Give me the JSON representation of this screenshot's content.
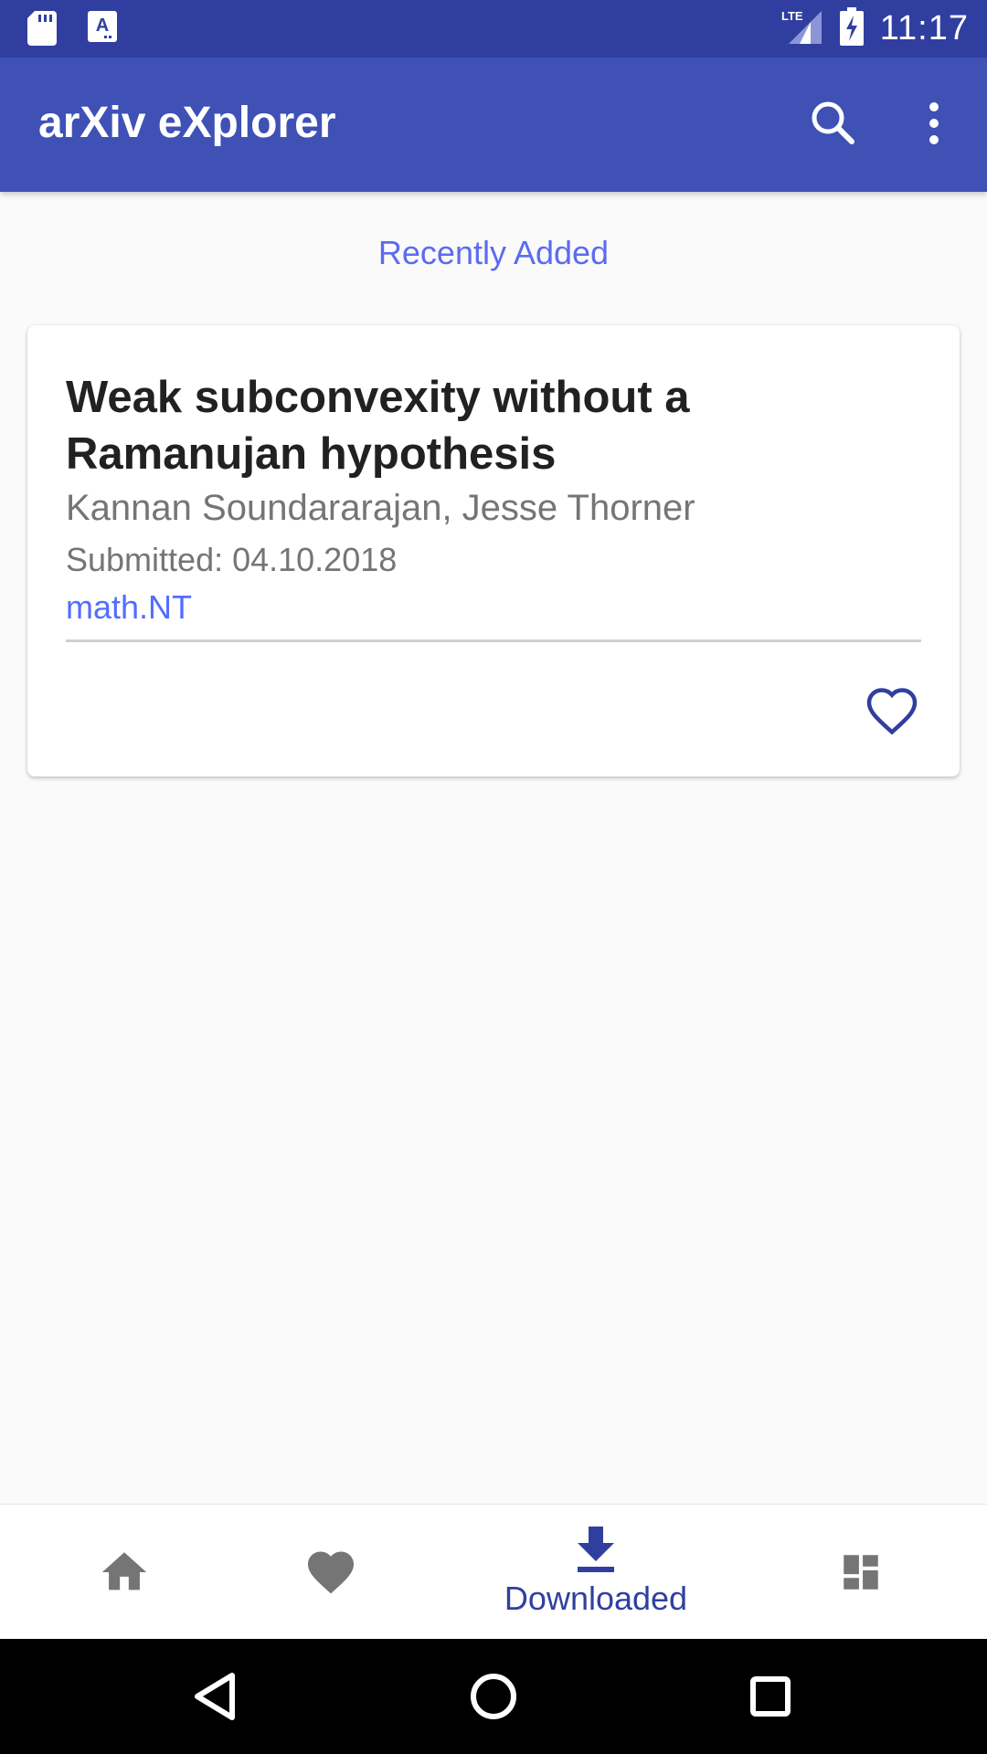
{
  "status_bar": {
    "time": "11:17",
    "network": "LTE",
    "left_icons": [
      "sd-card-icon",
      "font-a-icon"
    ],
    "right_icons": [
      "lte-signal-icon",
      "battery-charging-icon"
    ]
  },
  "app_bar": {
    "title": "arXiv eXplorer",
    "actions": [
      "search-icon",
      "more-vert-icon"
    ]
  },
  "section": {
    "heading": "Recently Added"
  },
  "papers": [
    {
      "title": "Weak subconvexity without a Ramanujan hypothesis",
      "authors": "Kannan Soundararajan, Jesse Thorner",
      "submitted": "Submitted: 04.10.2018",
      "category": "math.NT",
      "favorite_icon": "heart-outline-icon"
    }
  ],
  "bottom_nav": {
    "items": [
      {
        "icon": "home-icon",
        "label": ""
      },
      {
        "icon": "heart-icon",
        "label": ""
      },
      {
        "icon": "download-icon",
        "label": "Downloaded",
        "active": true
      },
      {
        "icon": "dashboard-icon",
        "label": ""
      }
    ]
  },
  "system_nav": [
    "back-icon",
    "home-circle-icon",
    "recent-apps-icon"
  ],
  "colors": {
    "status_bar": "#303f9f",
    "app_bar": "#3f51b5",
    "accent": "#536dfe",
    "nav_active": "#303f9f",
    "nav_inactive": "#757575"
  }
}
